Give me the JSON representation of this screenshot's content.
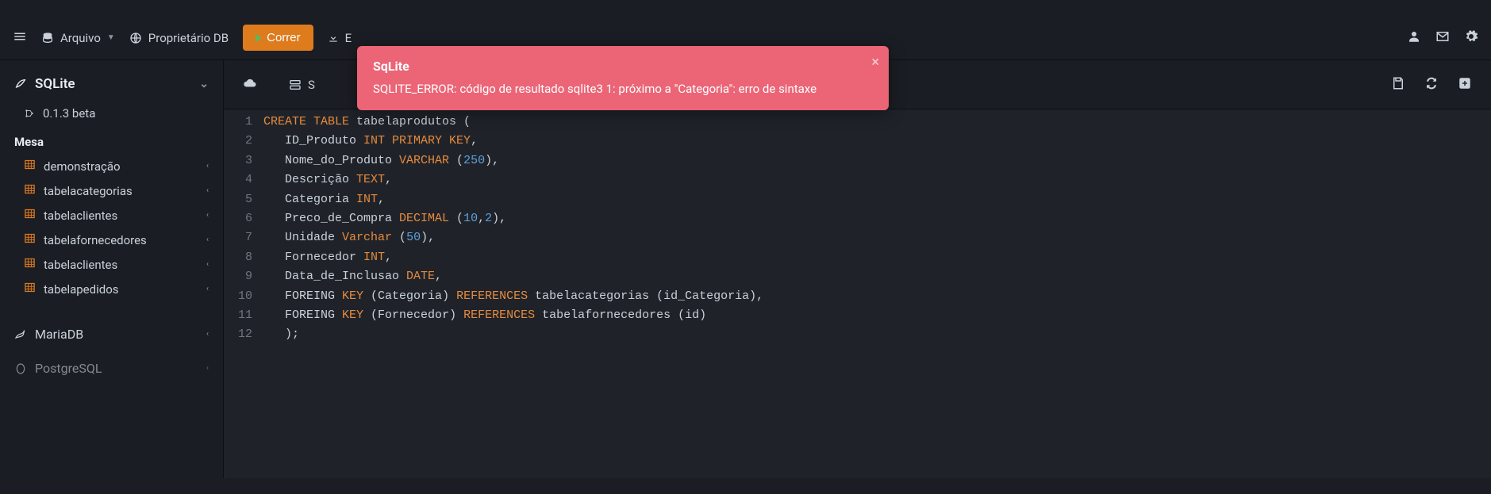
{
  "nav": {
    "archive_label": "Arquivo",
    "owner_label": "Proprietário DB",
    "run_label": "Correr",
    "export_prefix": "E"
  },
  "sidebar": {
    "db_active": "SQLite",
    "version": "0.1.3 beta",
    "section_title": "Mesa",
    "tables": [
      {
        "name": "demonstração"
      },
      {
        "name": "tabelacategorias"
      },
      {
        "name": "tabelaclientes"
      },
      {
        "name": "tabelafornecedores"
      },
      {
        "name": "tabelaclientes"
      },
      {
        "name": "tabelapedidos"
      }
    ],
    "db_mariadb": "MariaDB",
    "db_postgres": "PostgreSQL"
  },
  "toolbar": {
    "tab_prefix": "S"
  },
  "editor": {
    "lines": [
      [
        {
          "t": "CREATE TABLE",
          "c": "kw"
        },
        {
          "t": " tabelaprodutos ("
        }
      ],
      [
        {
          "t": "   ID_Produto "
        },
        {
          "t": "INT PRIMARY KEY",
          "c": "kw"
        },
        {
          "t": ","
        }
      ],
      [
        {
          "t": "   Nome_do_Produto "
        },
        {
          "t": "VARCHAR",
          "c": "kw"
        },
        {
          "t": " ("
        },
        {
          "t": "250",
          "c": "num"
        },
        {
          "t": "),"
        }
      ],
      [
        {
          "t": "   Descrição "
        },
        {
          "t": "TEXT",
          "c": "kw"
        },
        {
          "t": ","
        }
      ],
      [
        {
          "t": "   Categoria "
        },
        {
          "t": "INT",
          "c": "kw"
        },
        {
          "t": ","
        }
      ],
      [
        {
          "t": "   Preco_de_Compra "
        },
        {
          "t": "DECIMAL",
          "c": "kw"
        },
        {
          "t": " ("
        },
        {
          "t": "10",
          "c": "num"
        },
        {
          "t": ","
        },
        {
          "t": "2",
          "c": "num"
        },
        {
          "t": "),"
        }
      ],
      [
        {
          "t": "   Unidade "
        },
        {
          "t": "Varchar",
          "c": "kw"
        },
        {
          "t": " ("
        },
        {
          "t": "50",
          "c": "num"
        },
        {
          "t": "),"
        }
      ],
      [
        {
          "t": "   Fornecedor "
        },
        {
          "t": "INT",
          "c": "kw"
        },
        {
          "t": ","
        }
      ],
      [
        {
          "t": "   Data_de_Inclusao "
        },
        {
          "t": "DATE",
          "c": "kw"
        },
        {
          "t": ","
        }
      ],
      [
        {
          "t": "   FOREING "
        },
        {
          "t": "KEY",
          "c": "kw"
        },
        {
          "t": " (Categoria) "
        },
        {
          "t": "REFERENCES",
          "c": "kw"
        },
        {
          "t": " tabelacategorias (id_Categoria),"
        }
      ],
      [
        {
          "t": "   FOREING "
        },
        {
          "t": "KEY",
          "c": "kw"
        },
        {
          "t": " (Fornecedor) "
        },
        {
          "t": "REFERENCES",
          "c": "kw"
        },
        {
          "t": " tabelafornecedores (id)"
        }
      ],
      [
        {
          "t": "   );"
        }
      ]
    ]
  },
  "toast": {
    "title": "SqLite",
    "message": "SQLITE_ERROR: código de resultado sqlite3 1: próximo a \"Categoria\": erro de sintaxe"
  }
}
